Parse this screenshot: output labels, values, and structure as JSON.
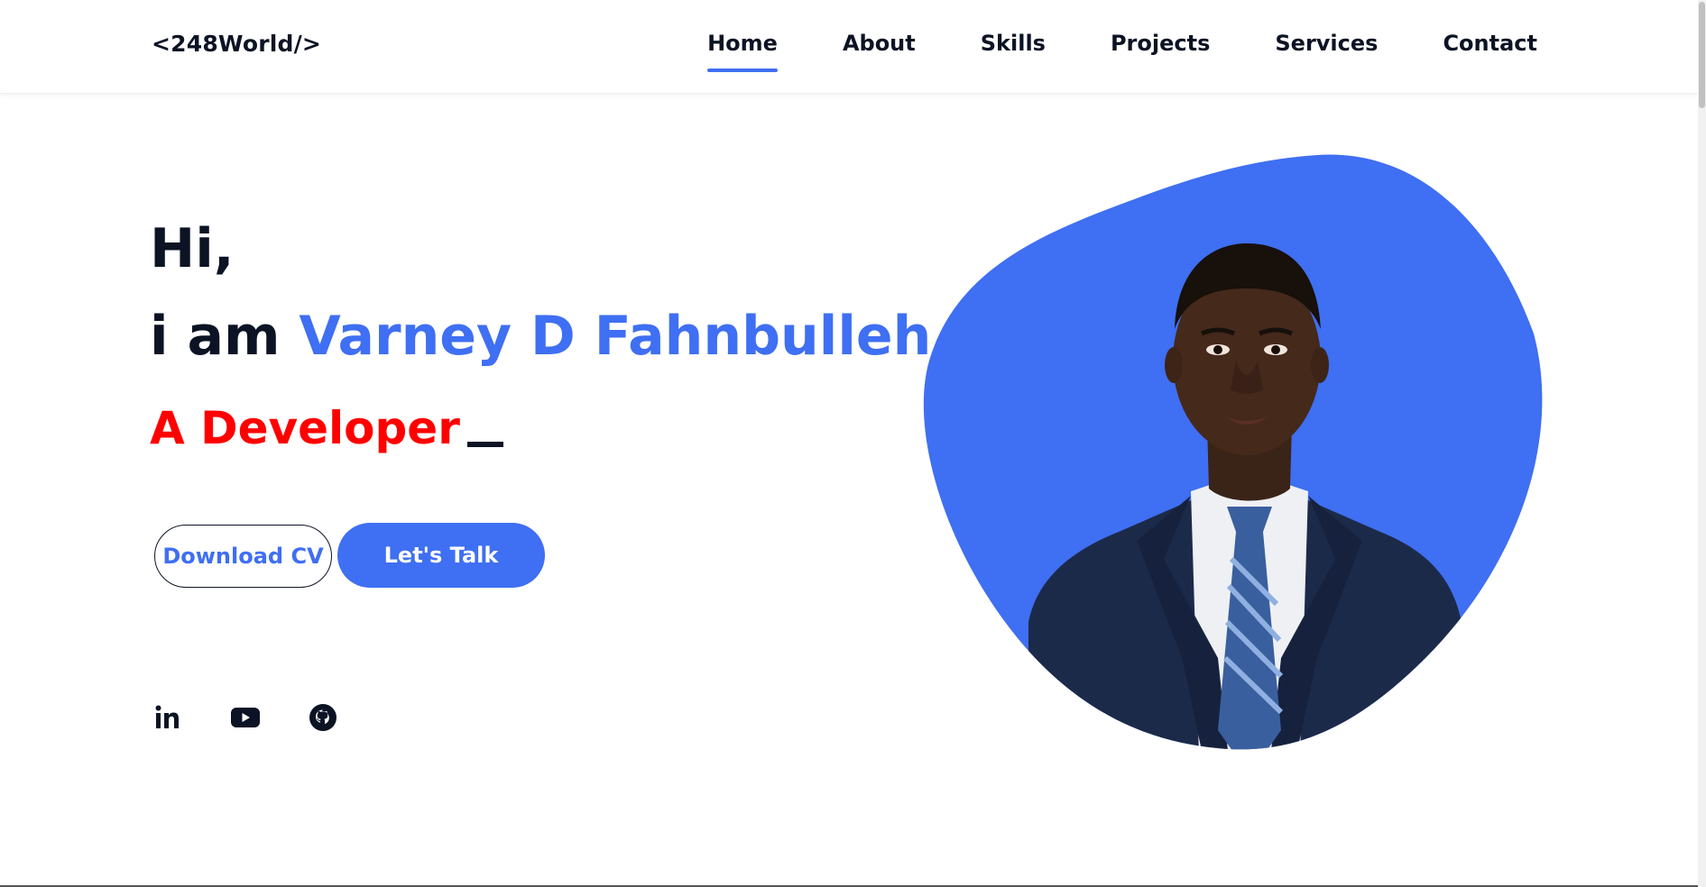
{
  "header": {
    "logo": "<248World/>",
    "nav": [
      {
        "label": "Home",
        "active": true
      },
      {
        "label": "About"
      },
      {
        "label": "Skills"
      },
      {
        "label": "Projects"
      },
      {
        "label": "Services"
      },
      {
        "label": "Contact"
      }
    ]
  },
  "hero": {
    "greeting": "Hi,",
    "intro_prefix": "i am",
    "name": "Varney D Fahnbulleh",
    "role": "A Developer",
    "buttons": {
      "download": "Download CV",
      "talk": "Let's Talk"
    }
  },
  "social": [
    {
      "icon": "linkedin-icon"
    },
    {
      "icon": "youtube-icon"
    },
    {
      "icon": "github-icon"
    }
  ],
  "colors": {
    "accent": "#3f6ff2",
    "dark": "#0b1324",
    "role": "#ff0000",
    "suit": "#1c2a4a"
  }
}
